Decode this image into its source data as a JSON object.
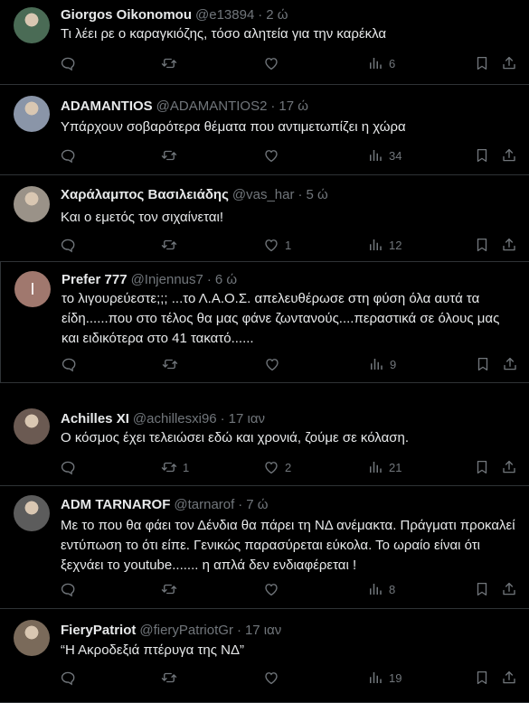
{
  "tweets": [
    {
      "name": "Giorgos Oikonomou",
      "handle": "@e13894",
      "sep": "·",
      "time": "2 ώ",
      "text": "Τι λέει ρε ο καραγκιόζης,  τόσο αλητεία για την καρέκλα",
      "replies": "",
      "retweets": "",
      "likes": "",
      "views": "6",
      "avatar": "#4a6b55"
    },
    {
      "name": "ADAMANTIOS",
      "handle": "@ADAMANTIOS2",
      "sep": "·",
      "time": "17 ώ",
      "text": "Υπάρχουν σοβαρότερα θέματα που αντιμετωπίζει η χώρα",
      "replies": "",
      "retweets": "",
      "likes": "",
      "views": "34",
      "avatar": "#8a95a8"
    },
    {
      "name": "Χαράλαμπος Βασιλειάδης",
      "handle": "@vas_har",
      "sep": "·",
      "time": "5 ώ",
      "text": "Και ο εμετός τον σιχαίνεται!",
      "replies": "",
      "retweets": "",
      "likes": "1",
      "views": "12",
      "avatar": "#9a9288"
    },
    {
      "name": "Prefer 777",
      "handle": "@Injennus7",
      "sep": "·",
      "time": "6 ώ",
      "text": "το λιγουρεύεστε;;; ...το Λ.Α.Ο.Σ. απελευθέρωσε στη φύση όλα αυτά τα είδη......που στο τέλος θα μας φάνε ζωντανούς....περαστικά σε όλους μας και ειδικότερα στο 41 τακατό......",
      "replies": "",
      "retweets": "",
      "likes": "",
      "views": "9",
      "avatar": "#a0786e",
      "initial": "I"
    },
    {
      "name": "Achilles XI",
      "handle": "@achillesxi96",
      "sep": "·",
      "time": "17 ιαν",
      "text": "Ο κόσμος έχει τελειώσει εδώ και χρονιά, ζούμε σε κόλαση.",
      "replies": "",
      "retweets": "1",
      "likes": "2",
      "views": "21",
      "avatar": "#6b5a52"
    },
    {
      "name": "ADM TARNAROF",
      "handle": "@tarnarof",
      "sep": "·",
      "time": "7 ώ",
      "text": "Με το που θα φάει τον Δένδια θα πάρει τη ΝΔ ανέμακτα. Πράγματι προκαλεί εντύπωση το ότι είπε. Γενικώς παρασύρεται εύκολα. Το ωραίο είναι ότι ξεχνάει το youtube....... η απλά δεν ενδιαφέρεται !",
      "replies": "",
      "retweets": "",
      "likes": "",
      "views": "8",
      "avatar": "#5c5c5c"
    },
    {
      "name": "FieryPatriot",
      "handle": "@fieryPatriotGr",
      "sep": "·",
      "time": "17 ιαν",
      "text": "“Η Ακροδεξιά πτέρυγα της ΝΔ”",
      "replies": "",
      "retweets": "",
      "likes": "",
      "views": "19",
      "avatar": "#7a6a5a"
    }
  ],
  "colors": {
    "bg": "#000000",
    "text": "#e7e9ea",
    "muted": "#71767b",
    "border": "#2f3336"
  }
}
